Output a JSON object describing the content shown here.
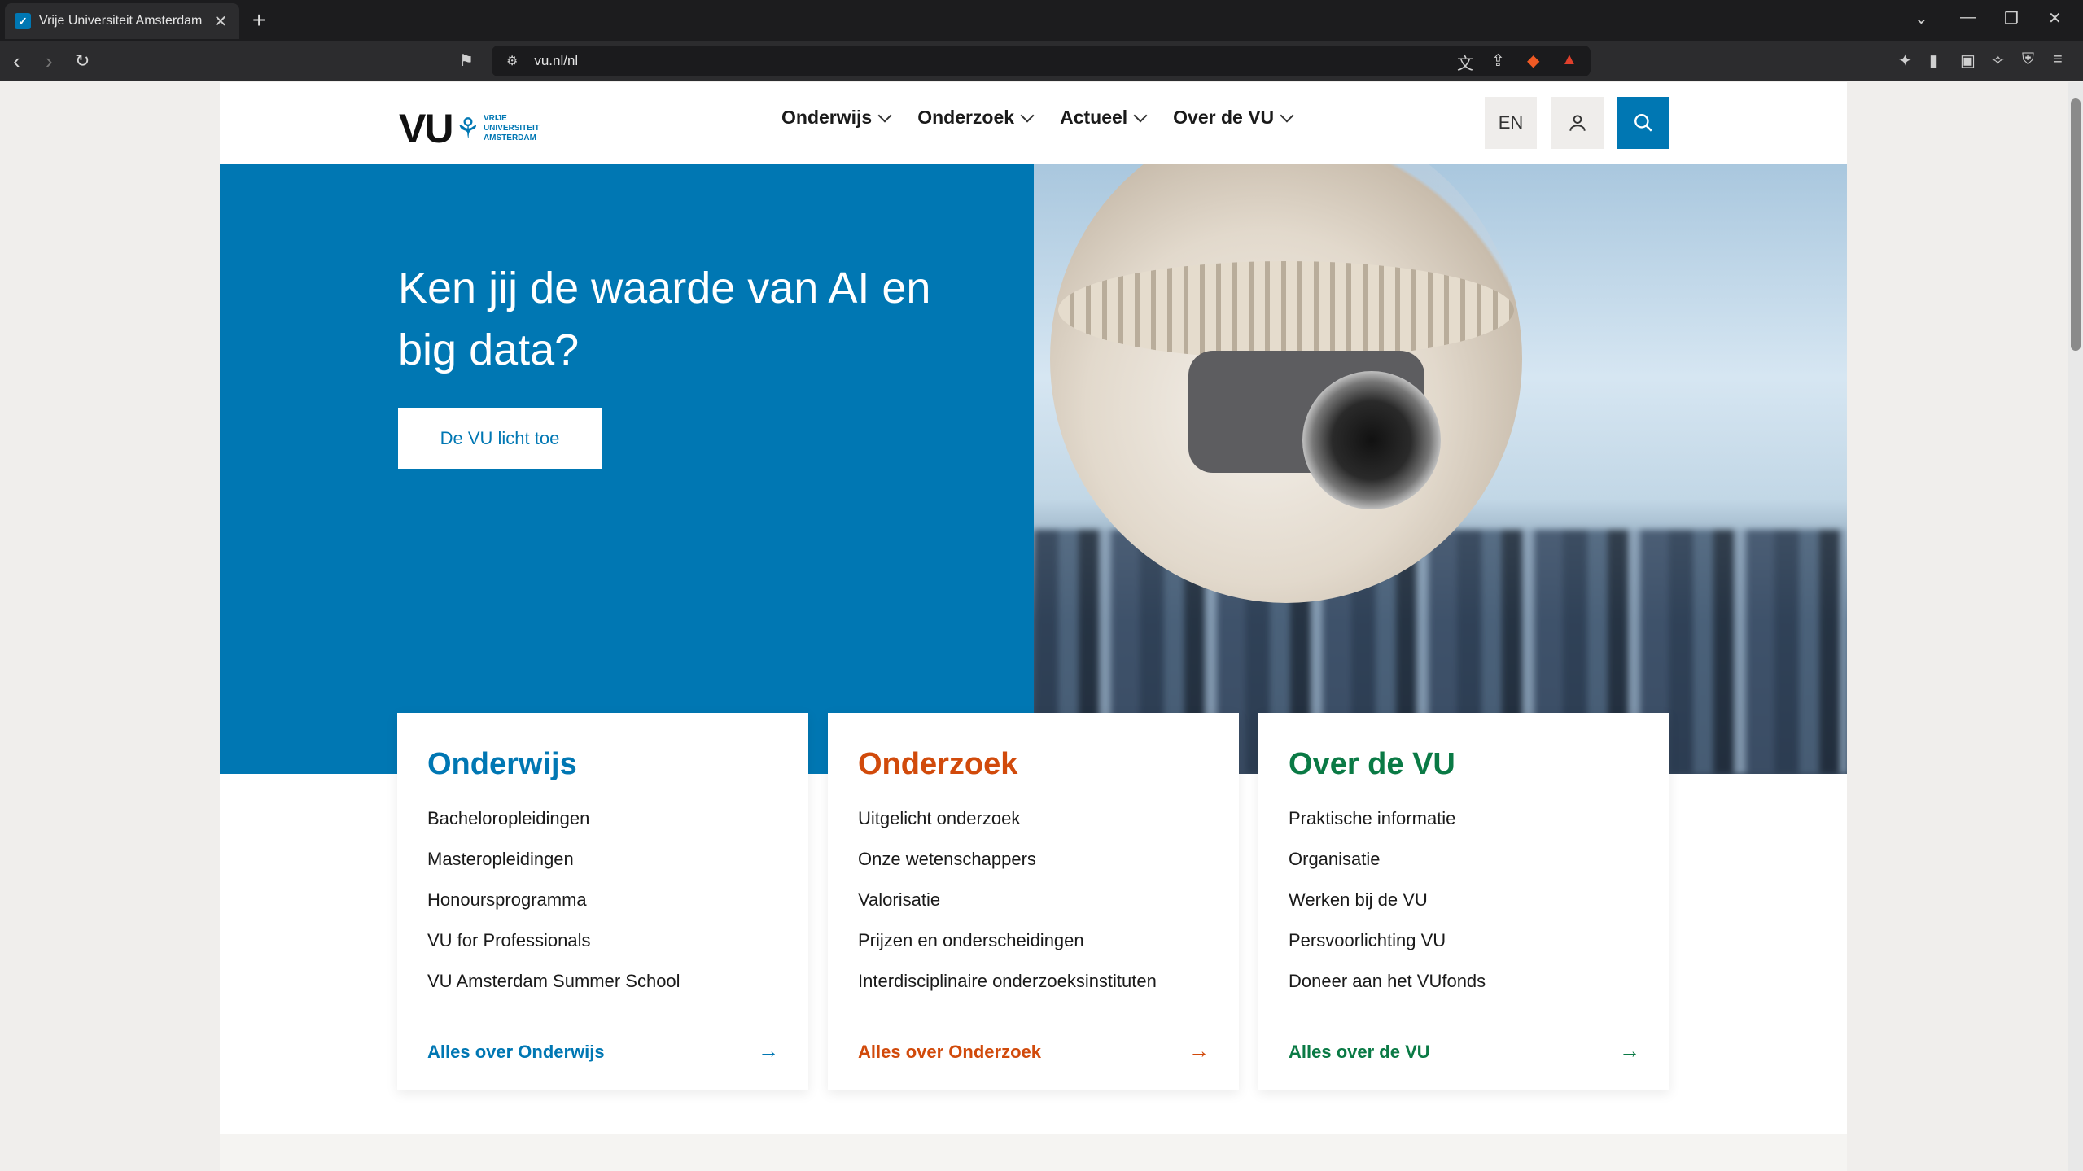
{
  "browser": {
    "tab_title": "Vrije Universiteit Amsterdam",
    "url": "vu.nl/nl"
  },
  "site": {
    "logo_main": "VU",
    "logo_sub": [
      "VRIJE",
      "UNIVERSITEIT",
      "AMSTERDAM"
    ],
    "nav": [
      "Onderwijs",
      "Onderzoek",
      "Actueel",
      "Over de VU"
    ],
    "lang": "EN"
  },
  "hero": {
    "title": "Ken jij de waarde van AI en big data?",
    "button": "De VU licht toe"
  },
  "cards": [
    {
      "title": "Onderwijs",
      "color": "#0077b3",
      "links": [
        "Bacheloropleidingen",
        "Masteropleidingen",
        "Honoursprogramma",
        "VU for Professionals",
        "VU Amsterdam Summer School"
      ],
      "more": "Alles over Onderwijs"
    },
    {
      "title": "Onderzoek",
      "color": "#d14a0b",
      "links": [
        "Uitgelicht onderzoek",
        "Onze wetenschappers",
        "Valorisatie",
        "Prijzen en onderscheidingen",
        "Interdisciplinaire onderzoeksinstituten"
      ],
      "more": "Alles over Onderzoek"
    },
    {
      "title": "Over de VU",
      "color": "#0a7a45",
      "links": [
        "Praktische informatie",
        "Organisatie",
        "Werken bij de VU",
        "Persvoorlichting VU",
        "Doneer aan het VUfonds"
      ],
      "more": "Alles over de VU"
    }
  ],
  "colors": {
    "brand_blue": "#0077b3"
  }
}
